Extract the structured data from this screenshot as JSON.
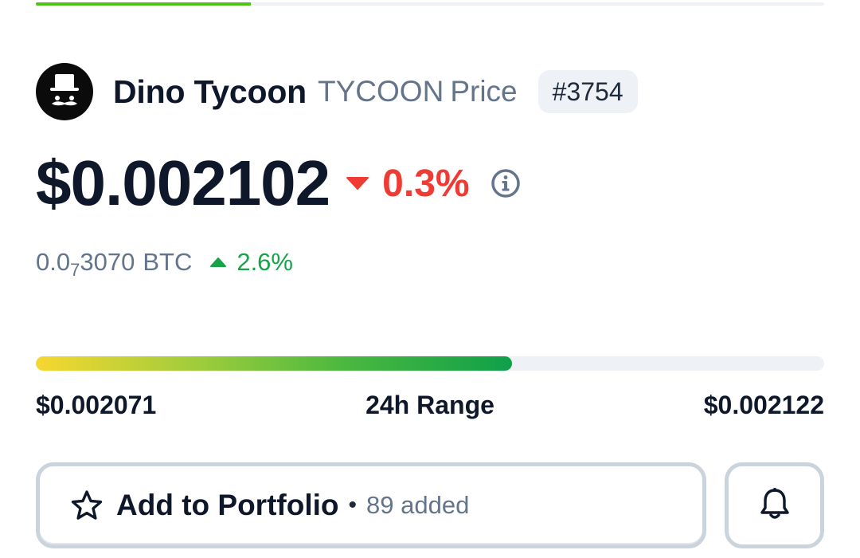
{
  "progress": {
    "fraction": 0.273,
    "color": "#4cc417"
  },
  "coin": {
    "name": "Dino Tycoon",
    "symbol": "TYCOON",
    "price_word": "Price",
    "rank": "#3754",
    "logo_icon": "top-hat-mustache-logo"
  },
  "price": {
    "usd": "$0.002102",
    "change_pct": "0.3%",
    "change_direction": "down",
    "change_color": "#ef3b34"
  },
  "btc": {
    "prefix": "0.0",
    "zero_count": "7",
    "digits": "3070",
    "unit": "BTC",
    "change_pct": "2.6%",
    "change_direction": "up",
    "change_color": "#16a34a"
  },
  "range": {
    "low": "$0.002071",
    "label": "24h Range",
    "high": "$0.002122",
    "position_fraction": 0.604
  },
  "actions": {
    "portfolio_label": "Add to Portfolio",
    "separator": "•",
    "added_count": "89 added",
    "star_icon": "star-outline-icon",
    "bell_icon": "bell-icon"
  }
}
